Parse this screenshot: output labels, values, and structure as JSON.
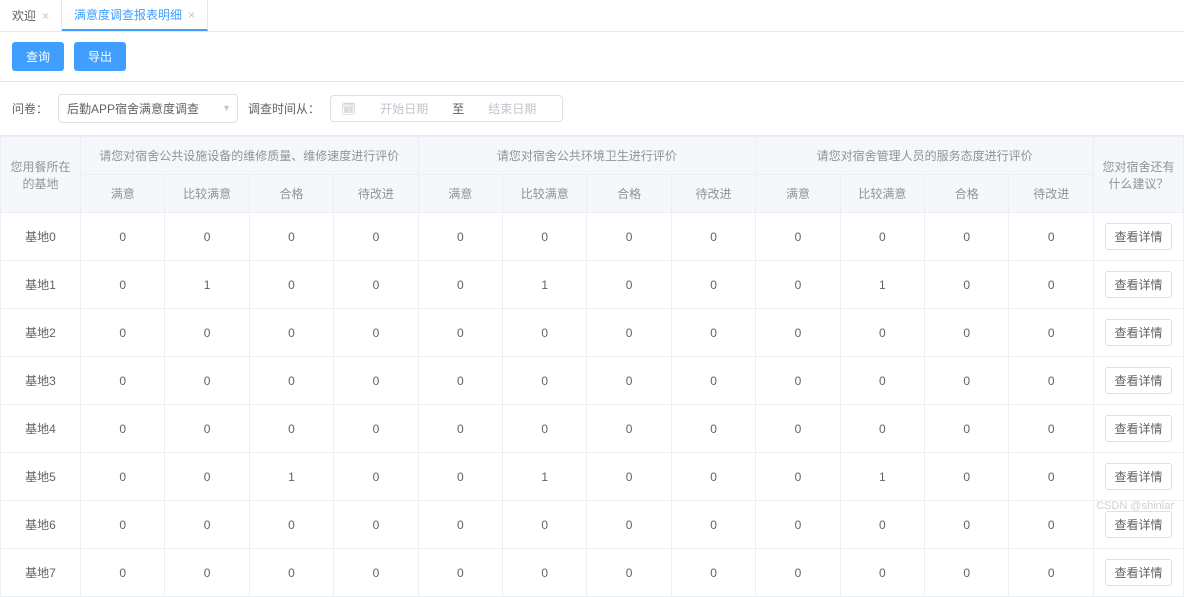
{
  "tabs": {
    "welcome": "欢迎",
    "report": "满意度调查报表明细"
  },
  "toolbar": {
    "query": "查询",
    "export": "导出"
  },
  "filter": {
    "questionnaire_label": "问卷：",
    "questionnaire_value": "后勤APP宿舍满意度调查",
    "time_label": "调查时间从：",
    "start_placeholder": "开始日期",
    "sep": "至",
    "end_placeholder": "结束日期"
  },
  "headers": {
    "base": "您用餐所在的基地",
    "g1": "请您对宿舍公共设施设备的维修质量、维修速度进行评价",
    "g2": "请您对宿舍公共环境卫生进行评价",
    "g3": "请您对宿舍管理人员的服务态度进行评价",
    "suggest": "您对宿舍还有什么建议？",
    "sub": {
      "c1": "满意",
      "c2": "比较满意",
      "c3": "合格",
      "c4": "待改进"
    },
    "action": "查看详情"
  },
  "rows": [
    {
      "base": "基地0",
      "v": [
        0,
        0,
        0,
        0,
        0,
        0,
        0,
        0,
        0,
        0,
        0,
        0
      ]
    },
    {
      "base": "基地1",
      "v": [
        0,
        1,
        0,
        0,
        0,
        1,
        0,
        0,
        0,
        1,
        0,
        0
      ]
    },
    {
      "base": "基地2",
      "v": [
        0,
        0,
        0,
        0,
        0,
        0,
        0,
        0,
        0,
        0,
        0,
        0
      ]
    },
    {
      "base": "基地3",
      "v": [
        0,
        0,
        0,
        0,
        0,
        0,
        0,
        0,
        0,
        0,
        0,
        0
      ]
    },
    {
      "base": "基地4",
      "v": [
        0,
        0,
        0,
        0,
        0,
        0,
        0,
        0,
        0,
        0,
        0,
        0
      ]
    },
    {
      "base": "基地5",
      "v": [
        0,
        0,
        1,
        0,
        0,
        1,
        0,
        0,
        0,
        1,
        0,
        0
      ]
    },
    {
      "base": "基地6",
      "v": [
        0,
        0,
        0,
        0,
        0,
        0,
        0,
        0,
        0,
        0,
        0,
        0
      ]
    },
    {
      "base": "基地7",
      "v": [
        0,
        0,
        0,
        0,
        0,
        0,
        0,
        0,
        0,
        0,
        0,
        0
      ]
    }
  ],
  "watermark": "CSDN @shinlar"
}
